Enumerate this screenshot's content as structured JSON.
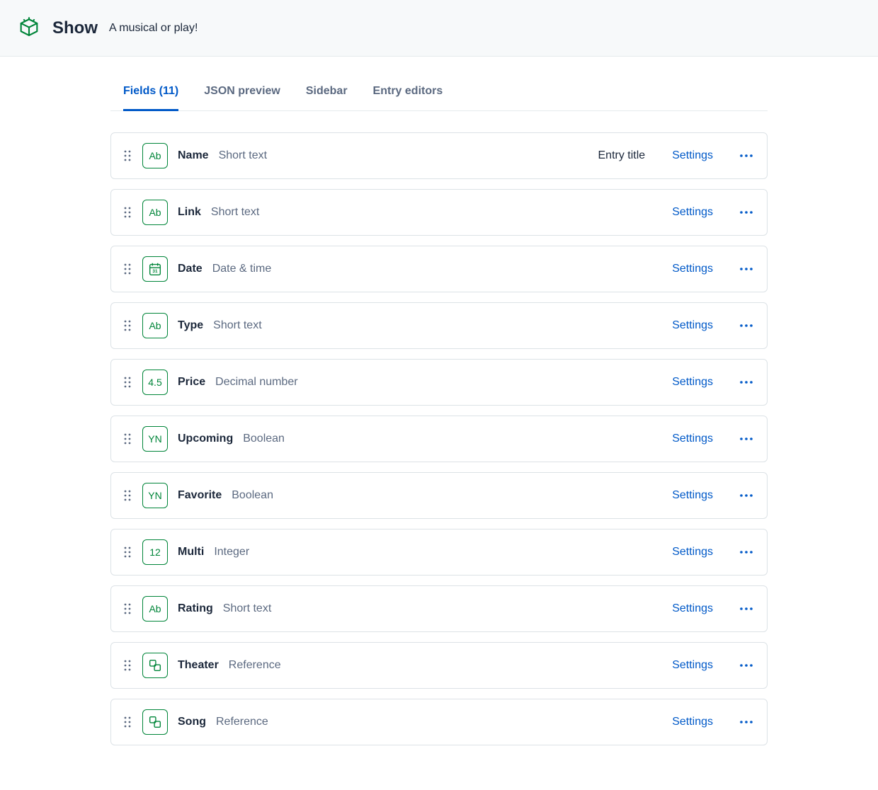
{
  "header": {
    "title": "Show",
    "description": "A musical or play!"
  },
  "tabs": [
    {
      "label": "Fields (11)",
      "active": true
    },
    {
      "label": "JSON preview",
      "active": false
    },
    {
      "label": "Sidebar",
      "active": false
    },
    {
      "label": "Entry editors",
      "active": false
    }
  ],
  "settingsLabel": "Settings",
  "entryTitleLabel": "Entry title",
  "fields": [
    {
      "name": "Name",
      "type": "Short text",
      "icon": "Ab",
      "iconKind": "text",
      "entryTitle": true
    },
    {
      "name": "Link",
      "type": "Short text",
      "icon": "Ab",
      "iconKind": "text",
      "entryTitle": false
    },
    {
      "name": "Date",
      "type": "Date & time",
      "icon": "calendar",
      "iconKind": "svg",
      "entryTitle": false
    },
    {
      "name": "Type",
      "type": "Short text",
      "icon": "Ab",
      "iconKind": "text",
      "entryTitle": false
    },
    {
      "name": "Price",
      "type": "Decimal number",
      "icon": "4.5",
      "iconKind": "text",
      "entryTitle": false
    },
    {
      "name": "Upcoming",
      "type": "Boolean",
      "icon": "YN",
      "iconKind": "text",
      "entryTitle": false
    },
    {
      "name": "Favorite",
      "type": "Boolean",
      "icon": "YN",
      "iconKind": "text",
      "entryTitle": false
    },
    {
      "name": "Multi",
      "type": "Integer",
      "icon": "12",
      "iconKind": "text",
      "entryTitle": false
    },
    {
      "name": "Rating",
      "type": "Short text",
      "icon": "Ab",
      "iconKind": "text",
      "entryTitle": false
    },
    {
      "name": "Theater",
      "type": "Reference",
      "icon": "reference",
      "iconKind": "svg",
      "entryTitle": false
    },
    {
      "name": "Song",
      "type": "Reference",
      "icon": "reference",
      "iconKind": "svg",
      "entryTitle": false
    }
  ]
}
